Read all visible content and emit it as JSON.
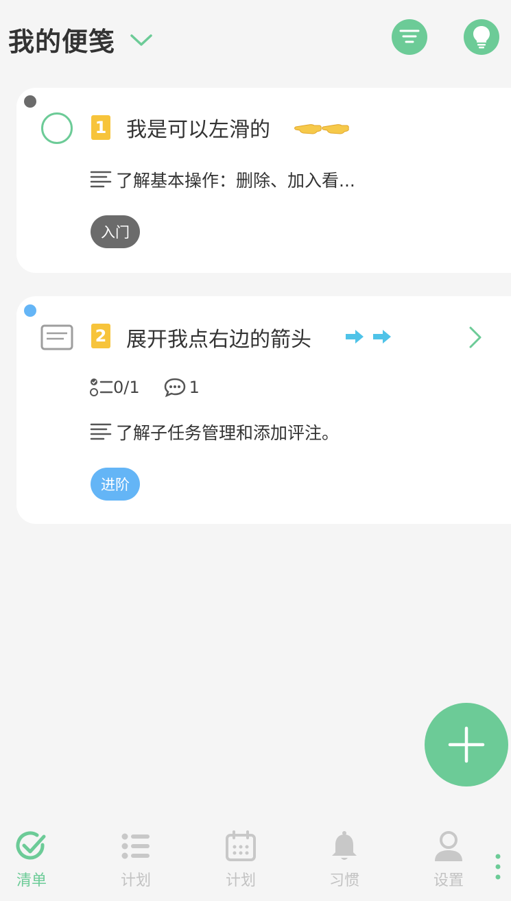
{
  "header": {
    "title": "我的便笺",
    "filter_icon": "filter-icon",
    "bulb_icon": "lightbulb-icon"
  },
  "cards": [
    {
      "priority": "1",
      "title": "我是可以左滑的",
      "emoji": "👈👈",
      "description": "了解基本操作：删除、加入看...",
      "tag": "入门",
      "tag_color": "#6b6b6b",
      "dot_color": "#6b6b6b"
    },
    {
      "priority": "2",
      "title": "展开我点右边的箭头",
      "emoji": "➡️➡️",
      "subtasks": "0/1",
      "comments": "1",
      "description": "了解子任务管理和添加评注。",
      "tag": "进阶",
      "tag_color": "#64b5f6",
      "dot_color": "#64b5f6"
    }
  ],
  "fab": {
    "icon": "plus-icon"
  },
  "nav": {
    "items": [
      {
        "label": "清单",
        "icon": "checkmark-circle-icon",
        "active": true
      },
      {
        "label": "计划",
        "icon": "list-icon",
        "active": false
      },
      {
        "label": "计划",
        "icon": "calendar-icon",
        "active": false
      },
      {
        "label": "习惯",
        "icon": "bell-icon",
        "active": false
      },
      {
        "label": "设置",
        "icon": "person-icon",
        "active": false
      }
    ]
  },
  "colors": {
    "accent": "#6ccb97",
    "priority": "#f7c43b",
    "background": "#f5f5f5"
  }
}
